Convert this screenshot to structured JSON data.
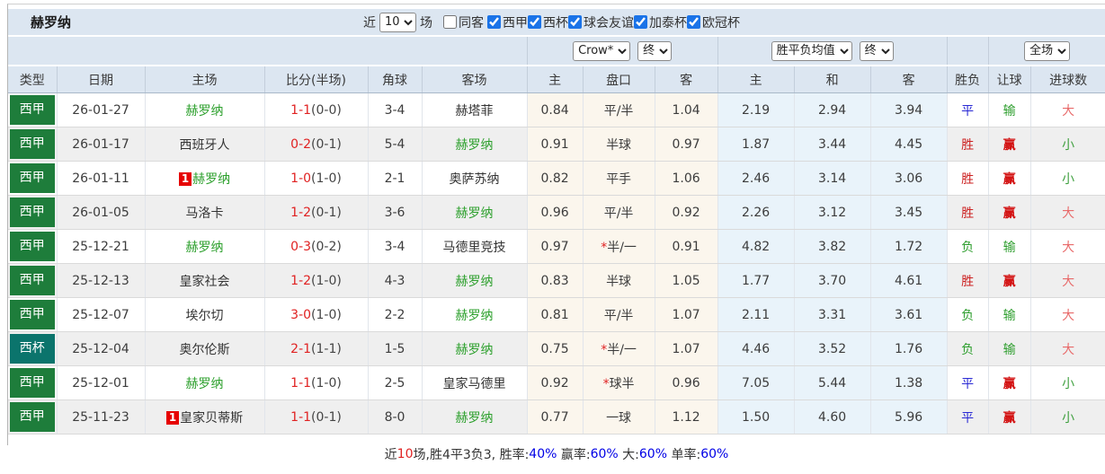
{
  "title": "赫罗纳",
  "toolbar": {
    "recent_label": "近",
    "matches_count": "10",
    "matches_label": "场",
    "same_venue_label": "同客",
    "same_venue_checked": false,
    "filters": [
      {
        "label": "西甲",
        "checked": true
      },
      {
        "label": "西杯",
        "checked": true
      },
      {
        "label": "球会友谊",
        "checked": true
      },
      {
        "label": "加泰杯",
        "checked": true
      },
      {
        "label": "欧冠杯",
        "checked": true
      }
    ]
  },
  "selectors": {
    "odds_company": "Crow*",
    "odds_stage": "终",
    "avg_type": "胜平负均值",
    "avg_stage": "终",
    "scope": "全场"
  },
  "columns": [
    "类型",
    "日期",
    "主场",
    "比分(半场)",
    "角球",
    "客场",
    "主",
    "盘口",
    "客",
    "主",
    "和",
    "客",
    "胜负",
    "让球",
    "进球数"
  ],
  "rows": [
    {
      "league": "西甲",
      "league_color": "green",
      "date": "26-01-27",
      "badge": "",
      "home": "赫罗纳",
      "home_color": "green",
      "score": "1-1",
      "half": "(0-0)",
      "corner": "3-4",
      "away": "赫塔菲",
      "away_color": "dark",
      "hcp_home": "0.84",
      "hcp_star": "",
      "hcp_line": "平/半",
      "hcp_away": "1.04",
      "avg_home": "2.19",
      "avg_draw": "2.94",
      "avg_away": "3.94",
      "result": "平",
      "result_color": "blue",
      "let_result": "输",
      "let_color": "green",
      "goals": "大",
      "goals_color": "red"
    },
    {
      "league": "西甲",
      "league_color": "green",
      "date": "26-01-17",
      "badge": "",
      "home": "西班牙人",
      "home_color": "dark",
      "score": "0-2",
      "half": "(0-1)",
      "corner": "5-4",
      "away": "赫罗纳",
      "away_color": "green",
      "hcp_home": "0.91",
      "hcp_star": "",
      "hcp_line": "半球",
      "hcp_away": "0.97",
      "avg_home": "1.87",
      "avg_draw": "3.44",
      "avg_away": "4.45",
      "result": "胜",
      "result_color": "red",
      "let_result": "赢",
      "let_color": "red",
      "goals": "小",
      "goals_color": "green"
    },
    {
      "league": "西甲",
      "league_color": "green",
      "date": "26-01-11",
      "badge": "1",
      "home": "赫罗纳",
      "home_color": "green",
      "score": "1-0",
      "half": "(1-0)",
      "corner": "2-1",
      "away": "奥萨苏纳",
      "away_color": "dark",
      "hcp_home": "0.82",
      "hcp_star": "",
      "hcp_line": "平手",
      "hcp_away": "1.06",
      "avg_home": "2.46",
      "avg_draw": "3.14",
      "avg_away": "3.06",
      "result": "胜",
      "result_color": "red",
      "let_result": "赢",
      "let_color": "red",
      "goals": "小",
      "goals_color": "green"
    },
    {
      "league": "西甲",
      "league_color": "green",
      "date": "26-01-05",
      "badge": "",
      "home": "马洛卡",
      "home_color": "dark",
      "score": "1-2",
      "half": "(0-1)",
      "corner": "3-6",
      "away": "赫罗纳",
      "away_color": "green",
      "hcp_home": "0.96",
      "hcp_star": "",
      "hcp_line": "平/半",
      "hcp_away": "0.92",
      "avg_home": "2.26",
      "avg_draw": "3.12",
      "avg_away": "3.45",
      "result": "胜",
      "result_color": "red",
      "let_result": "赢",
      "let_color": "red",
      "goals": "大",
      "goals_color": "red"
    },
    {
      "league": "西甲",
      "league_color": "green",
      "date": "25-12-21",
      "badge": "",
      "home": "赫罗纳",
      "home_color": "green",
      "score": "0-3",
      "half": "(0-2)",
      "corner": "3-4",
      "away": "马德里竞技",
      "away_color": "dark",
      "hcp_home": "0.97",
      "hcp_star": "*",
      "hcp_line": "半/一",
      "hcp_away": "0.91",
      "avg_home": "4.82",
      "avg_draw": "3.82",
      "avg_away": "1.72",
      "result": "负",
      "result_color": "green",
      "let_result": "输",
      "let_color": "green",
      "goals": "大",
      "goals_color": "red"
    },
    {
      "league": "西甲",
      "league_color": "green",
      "date": "25-12-13",
      "badge": "",
      "home": "皇家社会",
      "home_color": "dark",
      "score": "1-2",
      "half": "(1-0)",
      "corner": "4-3",
      "away": "赫罗纳",
      "away_color": "green",
      "hcp_home": "0.83",
      "hcp_star": "",
      "hcp_line": "半球",
      "hcp_away": "1.05",
      "avg_home": "1.77",
      "avg_draw": "3.70",
      "avg_away": "4.61",
      "result": "胜",
      "result_color": "red",
      "let_result": "赢",
      "let_color": "red",
      "goals": "大",
      "goals_color": "red"
    },
    {
      "league": "西甲",
      "league_color": "green",
      "date": "25-12-07",
      "badge": "",
      "home": "埃尔切",
      "home_color": "dark",
      "score": "3-0",
      "half": "(1-0)",
      "corner": "2-2",
      "away": "赫罗纳",
      "away_color": "green",
      "hcp_home": "0.81",
      "hcp_star": "",
      "hcp_line": "平/半",
      "hcp_away": "1.07",
      "avg_home": "2.11",
      "avg_draw": "3.31",
      "avg_away": "3.61",
      "result": "负",
      "result_color": "green",
      "let_result": "输",
      "let_color": "green",
      "goals": "大",
      "goals_color": "red"
    },
    {
      "league": "西杯",
      "league_color": "teal",
      "date": "25-12-04",
      "badge": "",
      "home": "奥尔伦斯",
      "home_color": "dark",
      "score": "2-1",
      "half": "(1-1)",
      "corner": "1-5",
      "away": "赫罗纳",
      "away_color": "green",
      "hcp_home": "0.75",
      "hcp_star": "*",
      "hcp_line": "半/一",
      "hcp_away": "1.07",
      "avg_home": "4.46",
      "avg_draw": "3.52",
      "avg_away": "1.76",
      "result": "负",
      "result_color": "green",
      "let_result": "输",
      "let_color": "green",
      "goals": "大",
      "goals_color": "red"
    },
    {
      "league": "西甲",
      "league_color": "green",
      "date": "25-12-01",
      "badge": "",
      "home": "赫罗纳",
      "home_color": "green",
      "score": "1-1",
      "half": "(1-0)",
      "corner": "2-5",
      "away": "皇家马德里",
      "away_color": "dark",
      "hcp_home": "0.92",
      "hcp_star": "*",
      "hcp_line": "球半",
      "hcp_away": "0.96",
      "avg_home": "7.05",
      "avg_draw": "5.44",
      "avg_away": "1.38",
      "result": "平",
      "result_color": "blue",
      "let_result": "赢",
      "let_color": "red",
      "goals": "小",
      "goals_color": "green"
    },
    {
      "league": "西甲",
      "league_color": "green",
      "date": "25-11-23",
      "badge": "1",
      "home": "皇家贝蒂斯",
      "home_color": "dark",
      "score": "1-1",
      "half": "(0-1)",
      "corner": "8-0",
      "away": "赫罗纳",
      "away_color": "green",
      "hcp_home": "0.77",
      "hcp_star": "",
      "hcp_line": "一球",
      "hcp_away": "1.12",
      "avg_home": "1.50",
      "avg_draw": "4.60",
      "avg_away": "5.96",
      "result": "平",
      "result_color": "blue",
      "let_result": "赢",
      "let_color": "red",
      "goals": "小",
      "goals_color": "green"
    }
  ],
  "footer": {
    "recent_label": "近",
    "recent_count": "10",
    "record_text": "场,胜4平3负3, 胜率:",
    "win_rate": "40%",
    "asian_label": " 赢率:",
    "asian_rate": "60%",
    "big_label": " 大:",
    "big_rate": "60%",
    "single_label": " 单率:",
    "single_rate": "60%"
  },
  "colors": {
    "header_bg": "#dce6f1",
    "league_green": "#1e7d3b",
    "league_teal": "#0b746c",
    "team_green": "#2da02d",
    "score_red": "#e02222",
    "win_red": "#cc2222",
    "lose_green": "#2e9e2e",
    "draw_blue": "#2a2ad4",
    "rate_blue": "#0000e6",
    "handicap_col_bg": "#fbf6ed",
    "avg_col_bg": "#e9f3fa",
    "alt_row_bg": "#efefef"
  }
}
